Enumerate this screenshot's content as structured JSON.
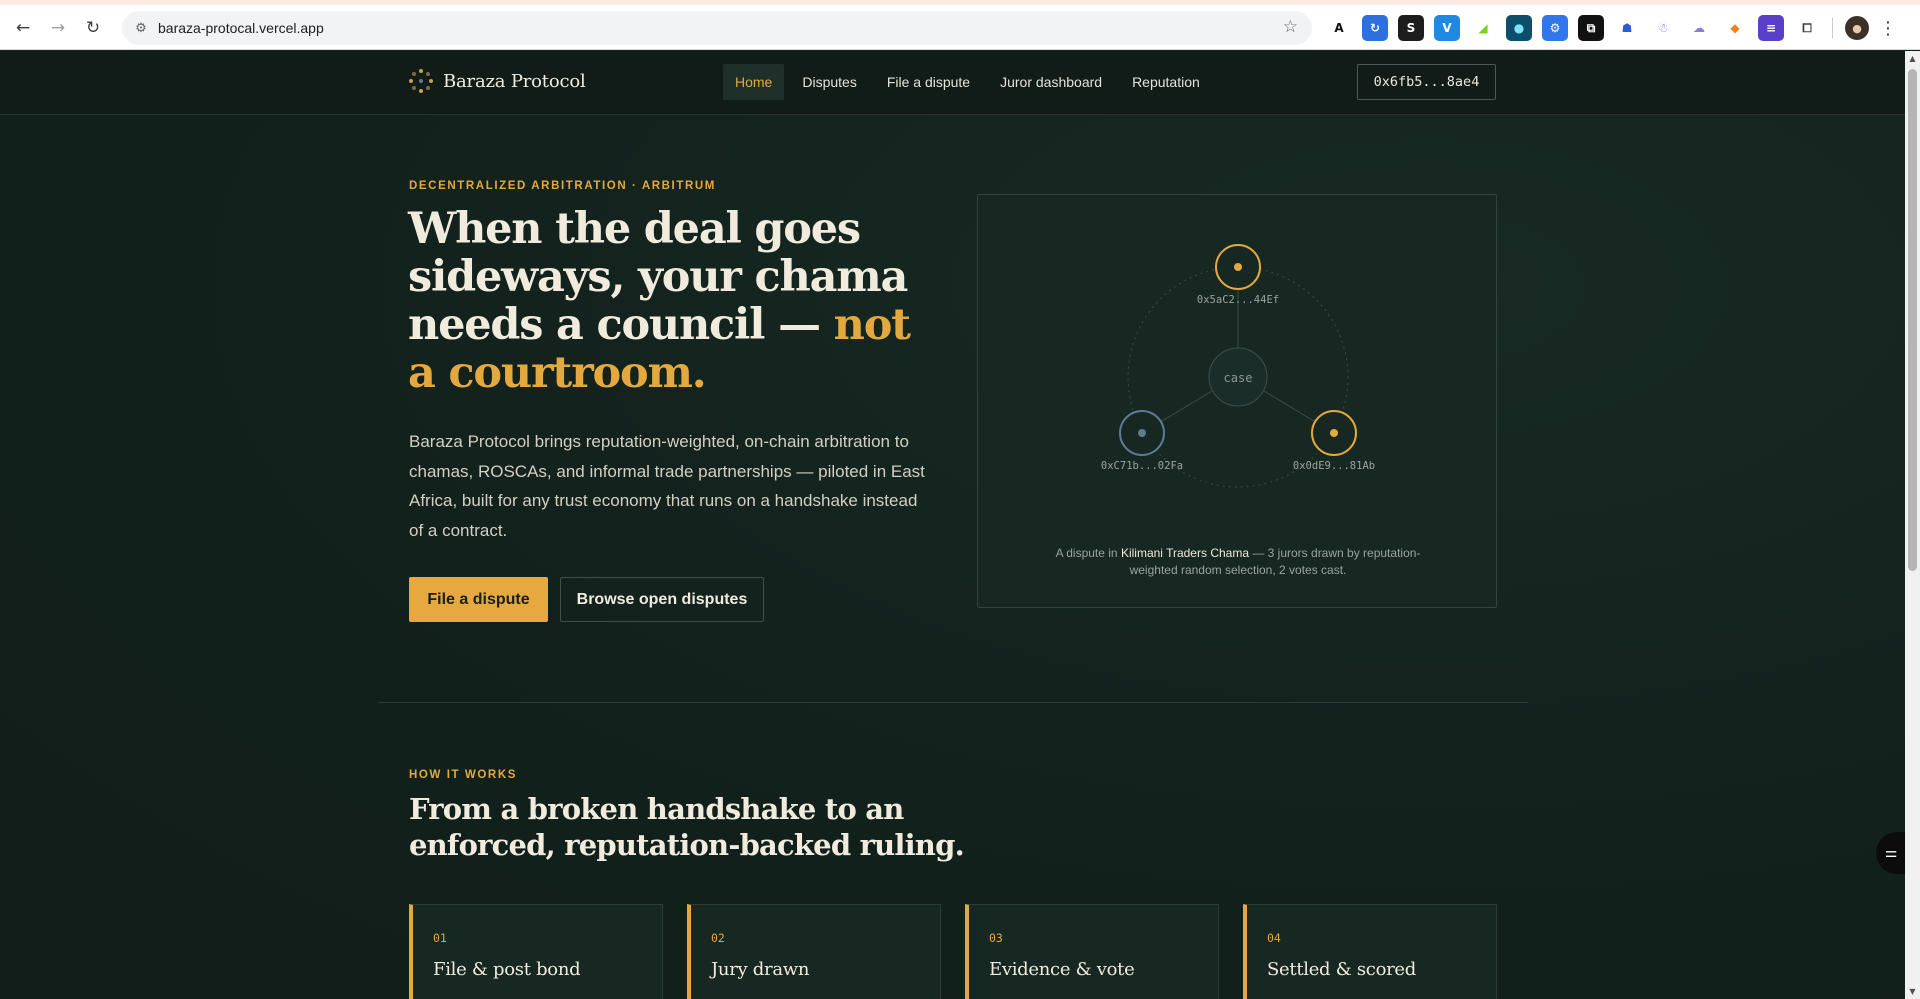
{
  "browser": {
    "url": "baraza-protocal.vercel.app",
    "extensions": [
      {
        "name": "a-ext-icon",
        "glyph": "A",
        "bg": "#ffffff",
        "fg": "#111111"
      },
      {
        "name": "refresh-ext-icon",
        "glyph": "↻",
        "bg": "#2b6fe0",
        "fg": "#ffffff"
      },
      {
        "name": "s-ext-icon",
        "glyph": "S",
        "bg": "#1d1d1d",
        "fg": "#ffffff"
      },
      {
        "name": "v-ext-icon",
        "glyph": "V",
        "bg": "#1e88e5",
        "fg": "#ffffff"
      },
      {
        "name": "chart-ext-icon",
        "glyph": "◢",
        "bg": "#ffffff",
        "fg": "#7ad21e"
      },
      {
        "name": "circle-ext-icon",
        "glyph": "●",
        "bg": "#0b4f6c",
        "fg": "#7fe0ff"
      },
      {
        "name": "gear-ext-icon",
        "glyph": "⚙",
        "bg": "#2f77ea",
        "fg": "#ffffff"
      },
      {
        "name": "square-ext-icon",
        "glyph": "⧉",
        "bg": "#111111",
        "fg": "#ffffff"
      },
      {
        "name": "hat-ext-icon",
        "glyph": "☗",
        "bg": "#ffffff",
        "fg": "#2c5bd8"
      },
      {
        "name": "robot-ext-icon",
        "glyph": "☃",
        "bg": "#ffffff",
        "fg": "#6a7be0"
      },
      {
        "name": "cloud-ext-icon",
        "glyph": "☁",
        "bg": "#ffffff",
        "fg": "#8d7bd6"
      },
      {
        "name": "fox-ext-icon",
        "glyph": "◆",
        "bg": "#ffffff",
        "fg": "#f0801f"
      },
      {
        "name": "doc-ext-icon",
        "glyph": "≡",
        "bg": "#5a3fc8",
        "fg": "#ffffff"
      },
      {
        "name": "puzzle-ext-icon",
        "glyph": "⧠",
        "bg": "#ffffff",
        "fg": "#3c4043"
      }
    ]
  },
  "site": {
    "brand": "Baraza Protocol",
    "nav": [
      {
        "label": "Home",
        "active": true
      },
      {
        "label": "Disputes",
        "active": false
      },
      {
        "label": "File a dispute",
        "active": false
      },
      {
        "label": "Juror dashboard",
        "active": false
      },
      {
        "label": "Reputation",
        "active": false
      }
    ],
    "wallet": "0x6fb5...8ae4"
  },
  "hero": {
    "eyebrow": "DECENTRALIZED ARBITRATION · ARBITRUM",
    "title_main": "When the deal goes sideways, your chama needs a council — ",
    "title_accent": "not a courtroom.",
    "lead": "Baraza Protocol brings reputation-weighted, on-chain arbitration to chamas, ROSCAs, and informal trade partnerships — piloted in East Africa, built for any trust economy that runs on a handshake instead of a contract.",
    "primary_cta": "File a dispute",
    "secondary_cta": "Browse open disputes"
  },
  "case_card": {
    "center_label": "case",
    "jurors": [
      {
        "address": "0x5aC2...44Ef",
        "voted": true
      },
      {
        "address": "0xC71b...02Fa",
        "voted": false
      },
      {
        "address": "0x0dE9...81Ab",
        "voted": true
      }
    ],
    "caption_prefix": "A dispute in ",
    "caption_group": "Kilimani Traders Chama",
    "caption_suffix": " — 3 jurors drawn by reputation-weighted random selection, 2 votes cast.",
    "colors": {
      "voted": "#e4a93e",
      "pending": "#5f7a94"
    }
  },
  "how": {
    "eyebrow": "HOW IT WORKS",
    "title": "From a broken handshake to an enforced, reputation-backed ruling.",
    "steps": [
      {
        "num": "01",
        "title": "File & post bond"
      },
      {
        "num": "02",
        "title": "Jury drawn"
      },
      {
        "num": "03",
        "title": "Evidence & vote"
      },
      {
        "num": "04",
        "title": "Settled & scored"
      }
    ]
  }
}
